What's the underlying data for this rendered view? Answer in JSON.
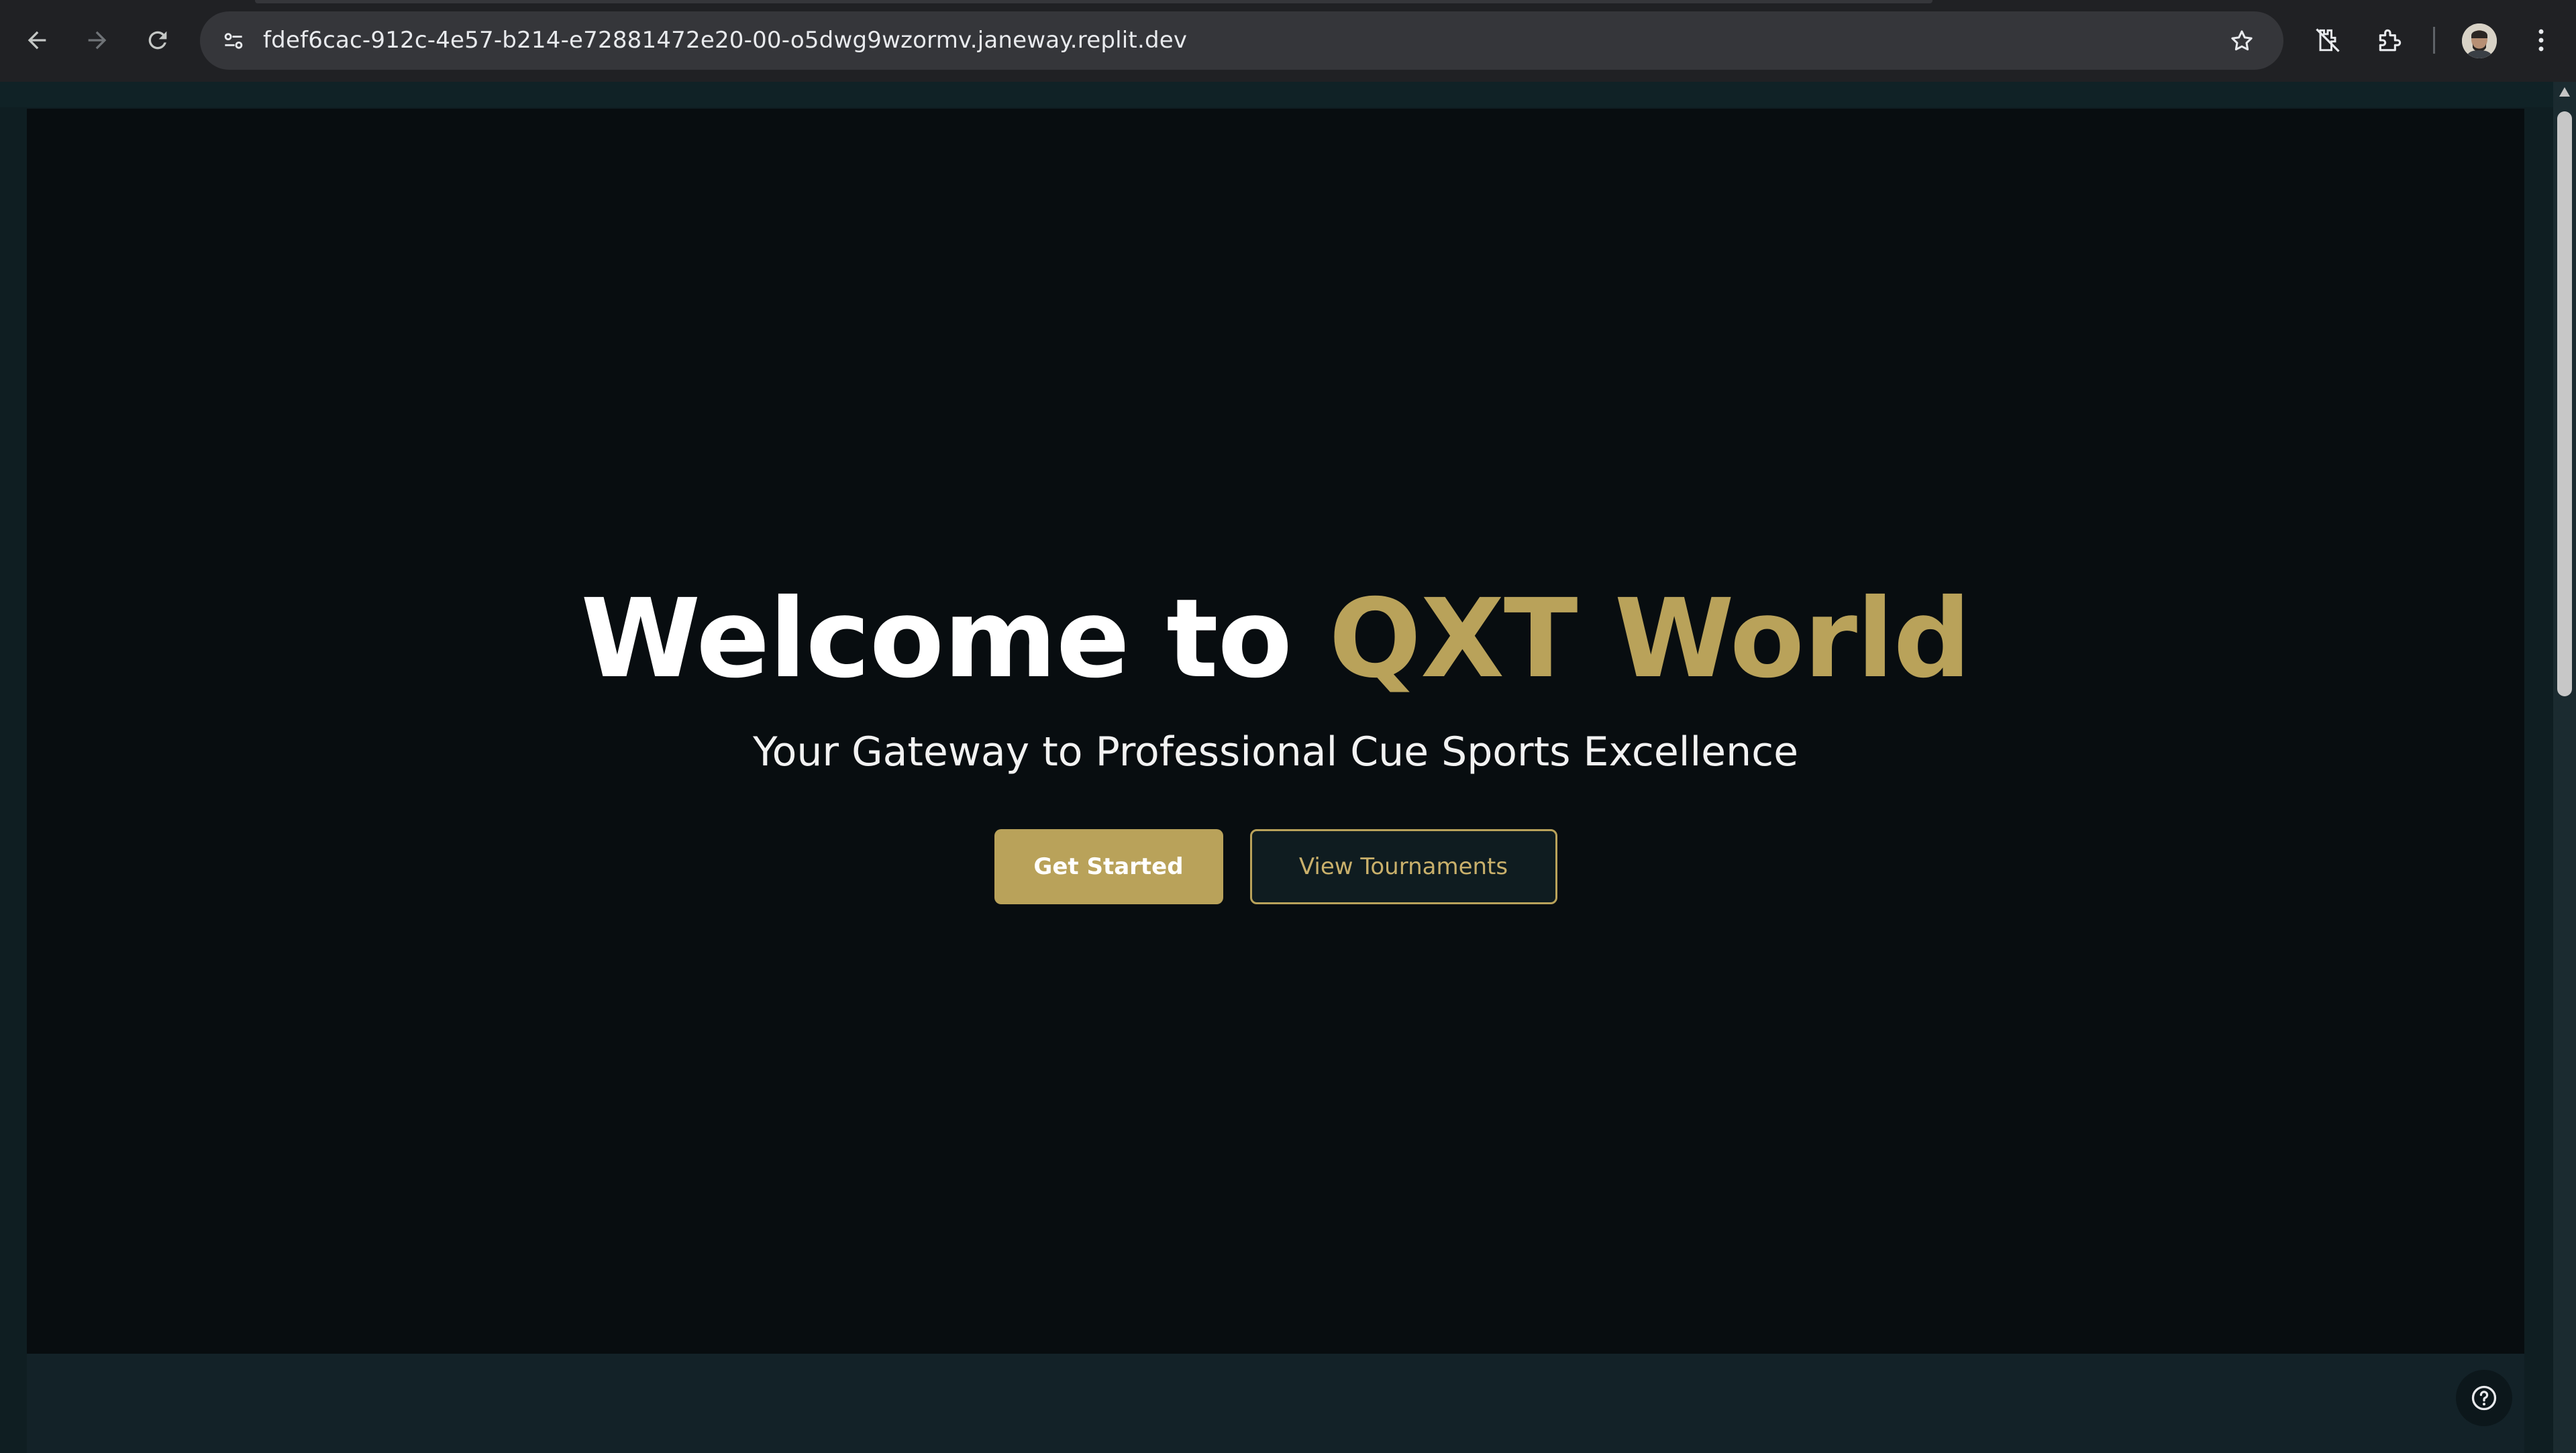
{
  "browser": {
    "url": "fdef6cac-912c-4e57-b214-e72881472e20-00-o5dwg9wzormv.janeway.replit.dev",
    "icons": [
      "back-arrow-icon",
      "forward-arrow-icon",
      "reload-icon",
      "site-settings-icon",
      "bookmark-star-icon",
      "extension-off-icon",
      "extensions-puzzle-icon",
      "profile-avatar",
      "kebab-menu-icon"
    ]
  },
  "hero": {
    "title_prefix": "Welcome to ",
    "title_accent": "QXT World",
    "subtitle": "Your Gateway to Professional Cue Sports Excellence",
    "primary_button": "Get Started",
    "secondary_button": "View Tournaments"
  },
  "colors": {
    "accent_gold": "#b9a25a",
    "hero_background": "#080d10",
    "page_background": "#0f1e22"
  },
  "help": {
    "icon": "question-circle-icon"
  }
}
